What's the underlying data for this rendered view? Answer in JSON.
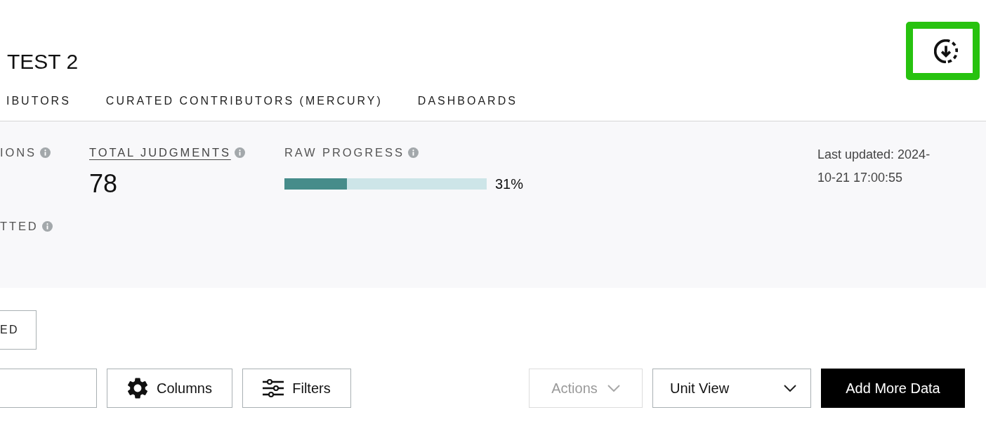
{
  "page": {
    "title": "TEST 2"
  },
  "download_button": {
    "highlighted": true
  },
  "tabs": [
    {
      "label": "IBUTORS",
      "selected": false
    },
    {
      "label": "CURATED CONTRIBUTORS (MERCURY)",
      "selected": false
    },
    {
      "label": "DASHBOARDS",
      "selected": false
    }
  ],
  "summary": {
    "metrics": [
      {
        "kind": "stat",
        "label": "IONS",
        "link": false
      },
      {
        "kind": "stat",
        "label": "TOTAL JUDGMENTS",
        "link": true,
        "value": "78"
      },
      {
        "kind": "progress",
        "label": "RAW PROGRESS",
        "link": false,
        "level": 0.31,
        "reading": "31%"
      }
    ],
    "second_row": [
      {
        "kind": "stat",
        "label": "TTED",
        "link": false
      }
    ],
    "last_updated": "Last updated: 2024-10-21 17:00:55"
  },
  "partial_button": {
    "label": "ED"
  },
  "toolbar": {
    "columns_button": {
      "label": "Columns"
    },
    "filters_button": {
      "label": "Filters"
    },
    "actions_menu": {
      "label": "Actions",
      "disabled": true
    },
    "view_select": {
      "value": "Unit View"
    },
    "add_button": {
      "label": "Add More Data"
    }
  }
}
